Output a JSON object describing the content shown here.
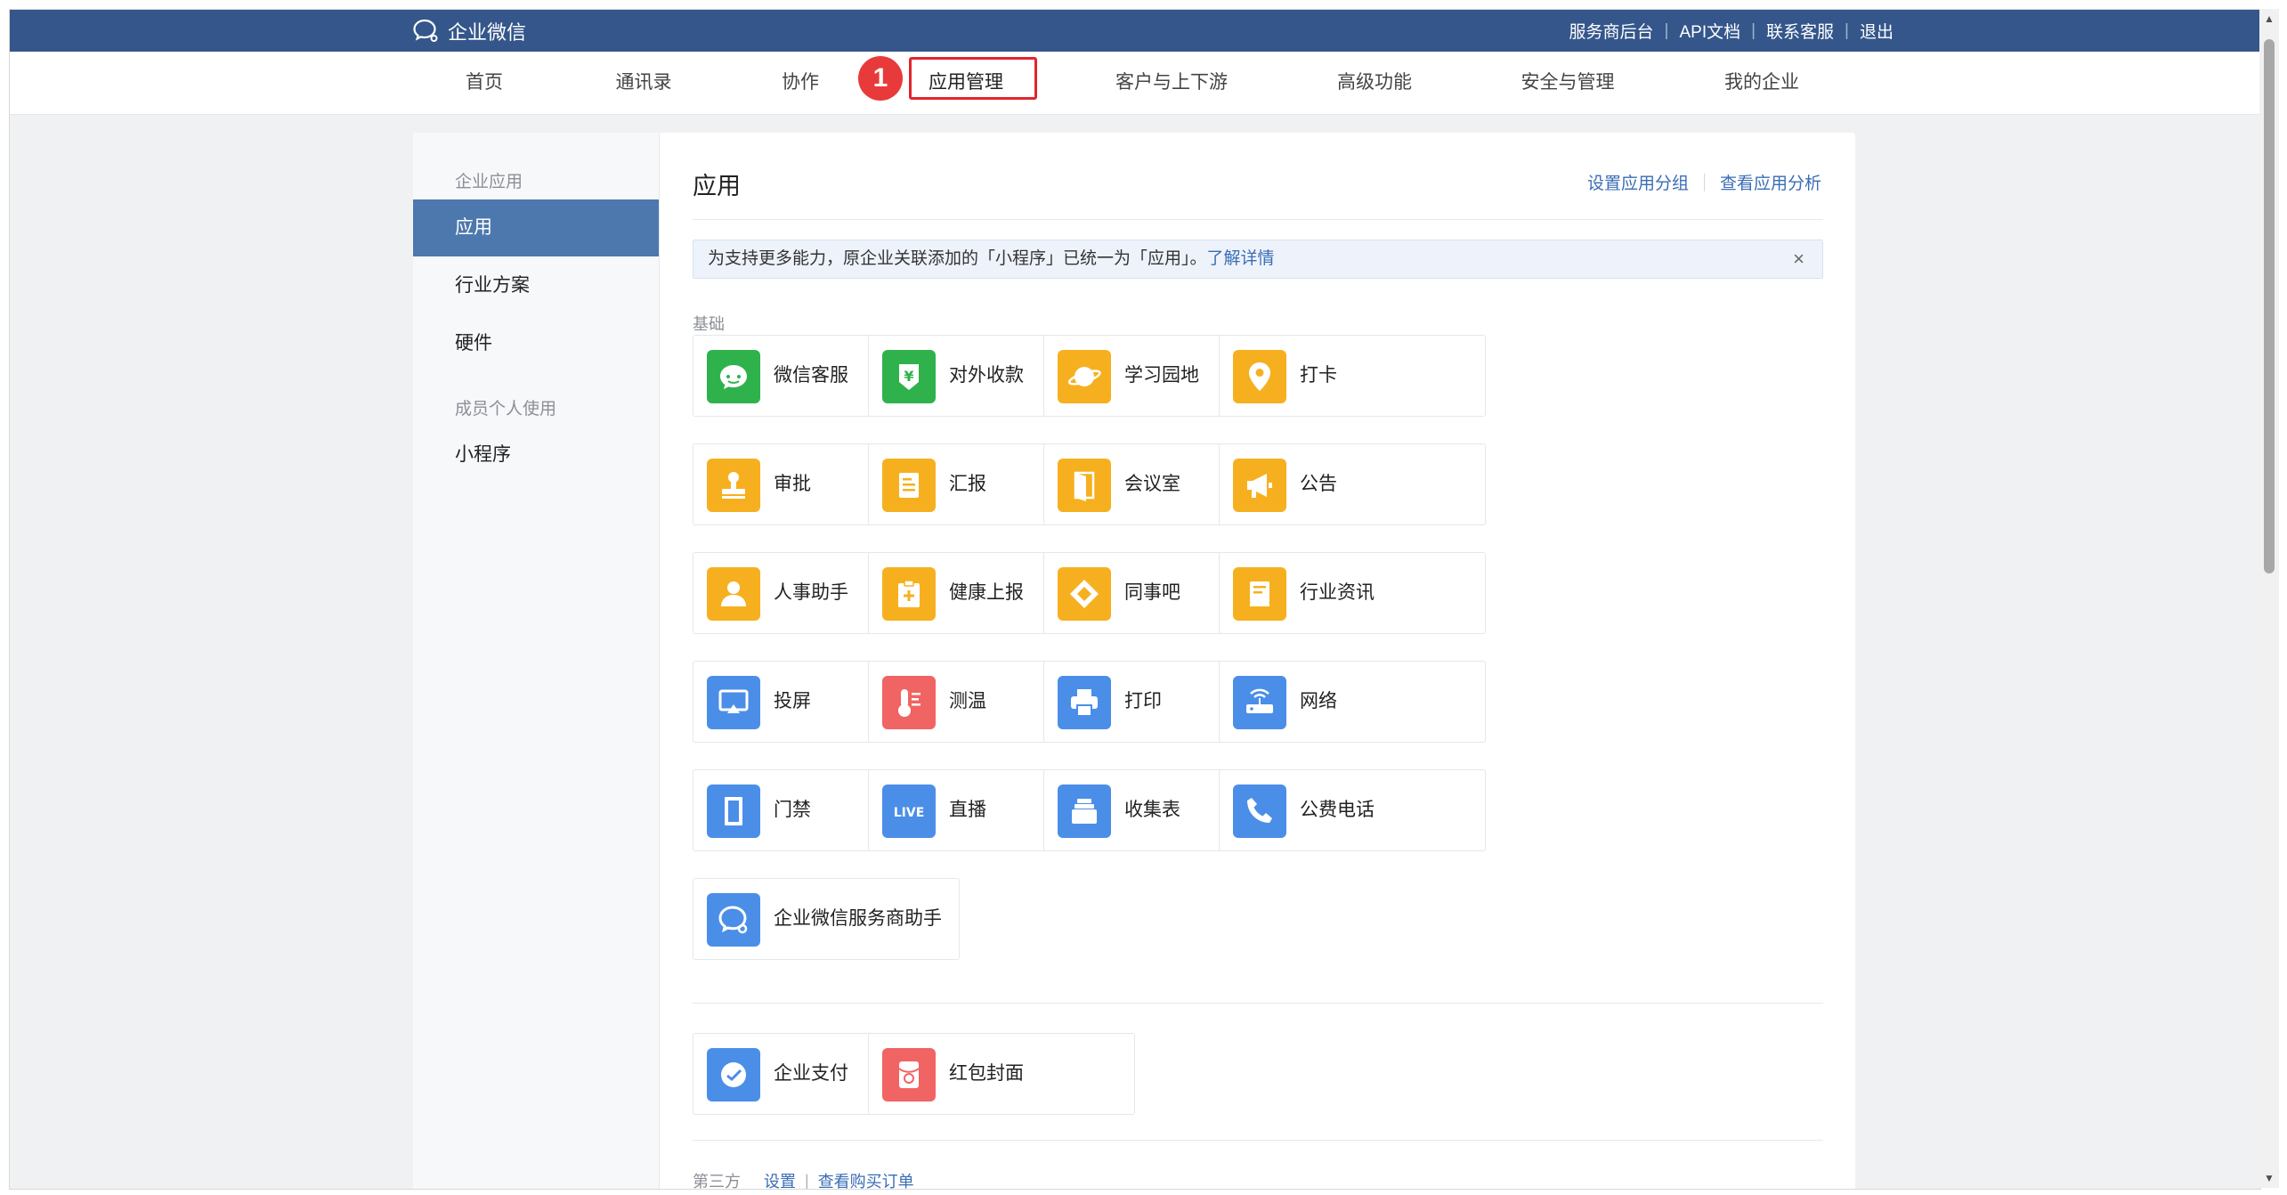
{
  "topbar": {
    "logo_text": "企业微信",
    "links": [
      "服务商后台",
      "API文档",
      "联系客服",
      "退出"
    ]
  },
  "nav": {
    "items": [
      "首页",
      "通讯录",
      "协作",
      "应用管理",
      "客户与上下游",
      "高级功能",
      "安全与管理",
      "我的企业"
    ],
    "active_index": 3,
    "step_badge": "1"
  },
  "sidebar": {
    "group1": "企业应用",
    "items1": [
      "应用",
      "行业方案",
      "硬件"
    ],
    "group2": "成员个人使用",
    "items2": [
      "小程序"
    ]
  },
  "main": {
    "title": "应用",
    "header_links": [
      "设置应用分组",
      "查看应用分析"
    ],
    "notice_text": "为支持更多能力，原企业关联添加的「小程序」已统一为「应用」。",
    "notice_link": "了解详情",
    "notice_close": "×",
    "section_basic": "基础",
    "apps_basic": [
      {
        "label": "微信客服",
        "icon": "wechat-service-icon",
        "color": "#2fb24c"
      },
      {
        "label": "对外收款",
        "icon": "payment-collection-icon",
        "color": "#2fb24c"
      },
      {
        "label": "学习园地",
        "icon": "planet-icon",
        "color": "#f6b01f"
      },
      {
        "label": "打卡",
        "icon": "location-pin-icon",
        "color": "#f6b01f"
      },
      {
        "label": "审批",
        "icon": "stamp-icon",
        "color": "#f6b01f"
      },
      {
        "label": "汇报",
        "icon": "report-document-icon",
        "color": "#f6b01f"
      },
      {
        "label": "会议室",
        "icon": "door-icon",
        "color": "#f6b01f"
      },
      {
        "label": "公告",
        "icon": "megaphone-icon",
        "color": "#f6b01f"
      },
      {
        "label": "人事助手",
        "icon": "person-icon",
        "color": "#f6b01f"
      },
      {
        "label": "健康上报",
        "icon": "health-clipboard-icon",
        "color": "#f6b01f"
      },
      {
        "label": "同事吧",
        "icon": "colleague-diamond-icon",
        "color": "#f6b01f"
      },
      {
        "label": "行业资讯",
        "icon": "news-scroll-icon",
        "color": "#f6b01f"
      },
      {
        "label": "投屏",
        "icon": "screen-cast-icon",
        "color": "#4b8ee8"
      },
      {
        "label": "测温",
        "icon": "thermometer-icon",
        "color": "#f06463"
      },
      {
        "label": "打印",
        "icon": "printer-icon",
        "color": "#4b8ee8"
      },
      {
        "label": "网络",
        "icon": "router-icon",
        "color": "#4b8ee8"
      },
      {
        "label": "门禁",
        "icon": "access-door-icon",
        "color": "#4b8ee8"
      },
      {
        "label": "直播",
        "icon": "live-icon",
        "color": "#4b8ee8",
        "glyph": "LIVE"
      },
      {
        "label": "收集表",
        "icon": "collection-form-icon",
        "color": "#4b8ee8"
      },
      {
        "label": "公费电话",
        "icon": "phone-icon",
        "color": "#4b8ee8"
      },
      {
        "label": "企业微信服务商助手",
        "icon": "wecom-chat-icon",
        "color": "#4b8ee8"
      }
    ],
    "apps_extra": [
      {
        "label": "企业支付",
        "icon": "enterprise-pay-icon",
        "color": "#4b8ee8"
      },
      {
        "label": "红包封面",
        "icon": "red-packet-icon",
        "color": "#f06463"
      }
    ],
    "third_party_label": "第三方",
    "third_party_links": [
      "设置",
      "查看购买订单"
    ]
  }
}
